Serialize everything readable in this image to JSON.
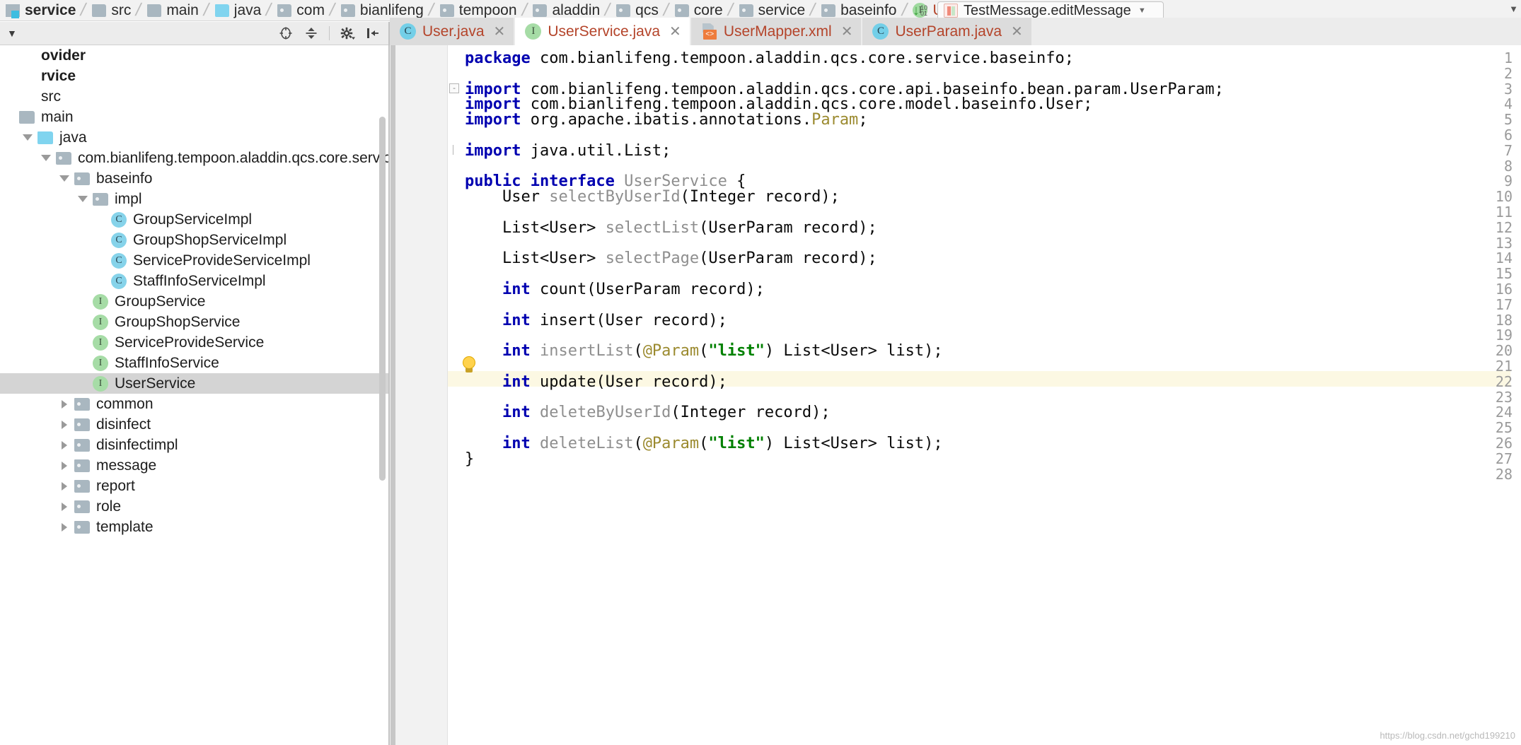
{
  "breadcrumb": {
    "items": [
      {
        "label": "service",
        "icon": "module-icon",
        "bold": true,
        "current": false
      },
      {
        "label": "src",
        "icon": "folder-grey-icon",
        "bold": false,
        "current": false
      },
      {
        "label": "main",
        "icon": "folder-grey-icon",
        "bold": false,
        "current": false
      },
      {
        "label": "java",
        "icon": "folder-blue-icon",
        "bold": false,
        "current": false
      },
      {
        "label": "com",
        "icon": "package-icon",
        "bold": false,
        "current": false
      },
      {
        "label": "bianlifeng",
        "icon": "package-icon",
        "bold": false,
        "current": false
      },
      {
        "label": "tempoon",
        "icon": "package-icon",
        "bold": false,
        "current": false
      },
      {
        "label": "aladdin",
        "icon": "package-icon",
        "bold": false,
        "current": false
      },
      {
        "label": "qcs",
        "icon": "package-icon",
        "bold": false,
        "current": false
      },
      {
        "label": "core",
        "icon": "package-icon",
        "bold": false,
        "current": false
      },
      {
        "label": "service",
        "icon": "package-icon",
        "bold": false,
        "current": false
      },
      {
        "label": "baseinfo",
        "icon": "package-icon",
        "bold": false,
        "current": false
      },
      {
        "label": "UserS",
        "icon": "interface-icon",
        "bold": false,
        "current": true
      }
    ],
    "separator": "/"
  },
  "run_widget": {
    "debug_badge": {
      "arrow": "↓",
      "bits_top": "10",
      "bits_bottom": "01"
    },
    "config_name": "TestMessage.editMessage",
    "caret": "▼"
  },
  "project_toolbar": {
    "collapse_caret": "▼",
    "buttons": [
      {
        "name": "locate-icon"
      },
      {
        "name": "collapse-all-icon"
      },
      {
        "name": "gear-icon"
      },
      {
        "name": "hide-panel-icon"
      }
    ]
  },
  "project_tree": {
    "rows": [
      {
        "label": "ovider",
        "indent": 0,
        "arrow": "none",
        "icon": "none",
        "bold": true,
        "selected": false
      },
      {
        "label": "rvice",
        "indent": 0,
        "arrow": "none",
        "icon": "none",
        "bold": true,
        "selected": false
      },
      {
        "label": "src",
        "indent": 0,
        "arrow": "none",
        "icon": "none",
        "bold": false,
        "selected": false
      },
      {
        "label": "main",
        "indent": 0,
        "arrow": "none",
        "icon": "folder-grey-icon",
        "bold": false,
        "selected": false
      },
      {
        "label": "java",
        "indent": 1,
        "arrow": "open",
        "icon": "folder-blue-icon",
        "bold": false,
        "selected": false
      },
      {
        "label": "com.bianlifeng.tempoon.aladdin.qcs.core.service",
        "indent": 2,
        "arrow": "open",
        "icon": "package-icon",
        "bold": false,
        "selected": false
      },
      {
        "label": "baseinfo",
        "indent": 3,
        "arrow": "open",
        "icon": "package-icon",
        "bold": false,
        "selected": false
      },
      {
        "label": "impl",
        "indent": 4,
        "arrow": "open",
        "icon": "package-icon",
        "bold": false,
        "selected": false
      },
      {
        "label": "GroupServiceImpl",
        "indent": 5,
        "arrow": "none",
        "icon": "class-icon",
        "bold": false,
        "selected": false
      },
      {
        "label": "GroupShopServiceImpl",
        "indent": 5,
        "arrow": "none",
        "icon": "class-icon",
        "bold": false,
        "selected": false
      },
      {
        "label": "ServiceProvideServiceImpl",
        "indent": 5,
        "arrow": "none",
        "icon": "class-icon",
        "bold": false,
        "selected": false
      },
      {
        "label": "StaffInfoServiceImpl",
        "indent": 5,
        "arrow": "none",
        "icon": "class-icon",
        "bold": false,
        "selected": false
      },
      {
        "label": "GroupService",
        "indent": 4,
        "arrow": "none",
        "icon": "interface-icon",
        "bold": false,
        "selected": false
      },
      {
        "label": "GroupShopService",
        "indent": 4,
        "arrow": "none",
        "icon": "interface-icon",
        "bold": false,
        "selected": false
      },
      {
        "label": "ServiceProvideService",
        "indent": 4,
        "arrow": "none",
        "icon": "interface-icon",
        "bold": false,
        "selected": false
      },
      {
        "label": "StaffInfoService",
        "indent": 4,
        "arrow": "none",
        "icon": "interface-icon",
        "bold": false,
        "selected": false
      },
      {
        "label": "UserService",
        "indent": 4,
        "arrow": "none",
        "icon": "interface-icon",
        "bold": false,
        "selected": true
      },
      {
        "label": "common",
        "indent": 3,
        "arrow": "closed",
        "icon": "package-icon",
        "bold": false,
        "selected": false
      },
      {
        "label": "disinfect",
        "indent": 3,
        "arrow": "closed",
        "icon": "package-icon",
        "bold": false,
        "selected": false
      },
      {
        "label": "disinfectimpl",
        "indent": 3,
        "arrow": "closed",
        "icon": "package-icon",
        "bold": false,
        "selected": false
      },
      {
        "label": "message",
        "indent": 3,
        "arrow": "closed",
        "icon": "package-icon",
        "bold": false,
        "selected": false
      },
      {
        "label": "report",
        "indent": 3,
        "arrow": "closed",
        "icon": "package-icon",
        "bold": false,
        "selected": false
      },
      {
        "label": "role",
        "indent": 3,
        "arrow": "closed",
        "icon": "package-icon",
        "bold": false,
        "selected": false
      },
      {
        "label": "template",
        "indent": 3,
        "arrow": "closed",
        "icon": "package-icon",
        "bold": false,
        "selected": false
      }
    ]
  },
  "editor_tabs": {
    "close_glyph": "✕",
    "tabs": [
      {
        "label": "User.java",
        "icon": "class-icon",
        "active": false
      },
      {
        "label": "UserService.java",
        "icon": "interface-icon",
        "active": true
      },
      {
        "label": "UserMapper.xml",
        "icon": "xml-file-icon",
        "active": false
      },
      {
        "label": "UserParam.java",
        "icon": "class-icon",
        "active": false
      }
    ]
  },
  "editor": {
    "highlighted_line": 22,
    "bulb_line": 21,
    "fold_markers": [
      {
        "line": 3,
        "glyph": "-"
      },
      {
        "line": 7,
        "glyph": "tail"
      }
    ],
    "watermark": "https://blog.csdn.net/gchd199210",
    "lines": [
      {
        "n": 1,
        "tokens": [
          {
            "t": "package ",
            "c": "kw"
          },
          {
            "t": "com.bianlifeng.tempoon.aladdin.qcs.core.service.baseinfo;",
            "c": "plain"
          }
        ]
      },
      {
        "n": 2,
        "tokens": []
      },
      {
        "n": 3,
        "tokens": [
          {
            "t": "import ",
            "c": "kw"
          },
          {
            "t": "com.bianlifeng.tempoon.aladdin.qcs.core.api.baseinfo.bean.param.UserParam;",
            "c": "plain"
          }
        ]
      },
      {
        "n": 4,
        "tokens": [
          {
            "t": "import ",
            "c": "kw"
          },
          {
            "t": "com.bianlifeng.tempoon.aladdin.qcs.core.model.baseinfo.User;",
            "c": "plain"
          }
        ]
      },
      {
        "n": 5,
        "tokens": [
          {
            "t": "import ",
            "c": "kw"
          },
          {
            "t": "org.apache.ibatis.annotations.",
            "c": "plain"
          },
          {
            "t": "Param",
            "c": "ann"
          },
          {
            "t": ";",
            "c": "plain"
          }
        ]
      },
      {
        "n": 6,
        "tokens": []
      },
      {
        "n": 7,
        "tokens": [
          {
            "t": "import ",
            "c": "kw"
          },
          {
            "t": "java.util.List;",
            "c": "plain"
          }
        ]
      },
      {
        "n": 8,
        "tokens": []
      },
      {
        "n": 9,
        "tokens": [
          {
            "t": "public interface ",
            "c": "kw"
          },
          {
            "t": "UserService",
            "c": "id-grey"
          },
          {
            "t": " {",
            "c": "plain"
          }
        ]
      },
      {
        "n": 10,
        "tokens": [
          {
            "t": "    User ",
            "c": "plain"
          },
          {
            "t": "selectByUserId",
            "c": "id-grey"
          },
          {
            "t": "(Integer record);",
            "c": "plain"
          }
        ]
      },
      {
        "n": 11,
        "tokens": []
      },
      {
        "n": 12,
        "tokens": [
          {
            "t": "    List<User> ",
            "c": "plain"
          },
          {
            "t": "selectList",
            "c": "id-grey"
          },
          {
            "t": "(UserParam record);",
            "c": "plain"
          }
        ]
      },
      {
        "n": 13,
        "tokens": []
      },
      {
        "n": 14,
        "tokens": [
          {
            "t": "    List<User> ",
            "c": "plain"
          },
          {
            "t": "selectPage",
            "c": "id-grey"
          },
          {
            "t": "(UserParam record);",
            "c": "plain"
          }
        ]
      },
      {
        "n": 15,
        "tokens": []
      },
      {
        "n": 16,
        "tokens": [
          {
            "t": "    ",
            "c": "plain"
          },
          {
            "t": "int",
            "c": "kw"
          },
          {
            "t": " count(UserParam record);",
            "c": "plain"
          }
        ]
      },
      {
        "n": 17,
        "tokens": []
      },
      {
        "n": 18,
        "tokens": [
          {
            "t": "    ",
            "c": "plain"
          },
          {
            "t": "int",
            "c": "kw"
          },
          {
            "t": " insert(User record);",
            "c": "plain"
          }
        ]
      },
      {
        "n": 19,
        "tokens": []
      },
      {
        "n": 20,
        "tokens": [
          {
            "t": "    ",
            "c": "plain"
          },
          {
            "t": "int",
            "c": "kw"
          },
          {
            "t": " ",
            "c": "plain"
          },
          {
            "t": "insertList",
            "c": "id-grey"
          },
          {
            "t": "(",
            "c": "plain"
          },
          {
            "t": "@Param",
            "c": "ann"
          },
          {
            "t": "(",
            "c": "plain"
          },
          {
            "t": "\"list\"",
            "c": "str"
          },
          {
            "t": ") List<User> list);",
            "c": "plain"
          }
        ]
      },
      {
        "n": 21,
        "tokens": []
      },
      {
        "n": 22,
        "tokens": [
          {
            "t": "    ",
            "c": "plain"
          },
          {
            "t": "int",
            "c": "kw"
          },
          {
            "t": " update(User record);",
            "c": "plain"
          }
        ]
      },
      {
        "n": 23,
        "tokens": []
      },
      {
        "n": 24,
        "tokens": [
          {
            "t": "    ",
            "c": "plain"
          },
          {
            "t": "int",
            "c": "kw"
          },
          {
            "t": " ",
            "c": "plain"
          },
          {
            "t": "deleteByUserId",
            "c": "id-grey"
          },
          {
            "t": "(Integer record);",
            "c": "plain"
          }
        ]
      },
      {
        "n": 25,
        "tokens": []
      },
      {
        "n": 26,
        "tokens": [
          {
            "t": "    ",
            "c": "plain"
          },
          {
            "t": "int",
            "c": "kw"
          },
          {
            "t": " ",
            "c": "plain"
          },
          {
            "t": "deleteList",
            "c": "id-grey"
          },
          {
            "t": "(",
            "c": "plain"
          },
          {
            "t": "@Param",
            "c": "ann"
          },
          {
            "t": "(",
            "c": "plain"
          },
          {
            "t": "\"list\"",
            "c": "str"
          },
          {
            "t": ") List<User> list);",
            "c": "plain"
          }
        ]
      },
      {
        "n": 27,
        "tokens": [
          {
            "t": "}",
            "c": "plain"
          }
        ]
      },
      {
        "n": 28,
        "tokens": []
      }
    ]
  }
}
